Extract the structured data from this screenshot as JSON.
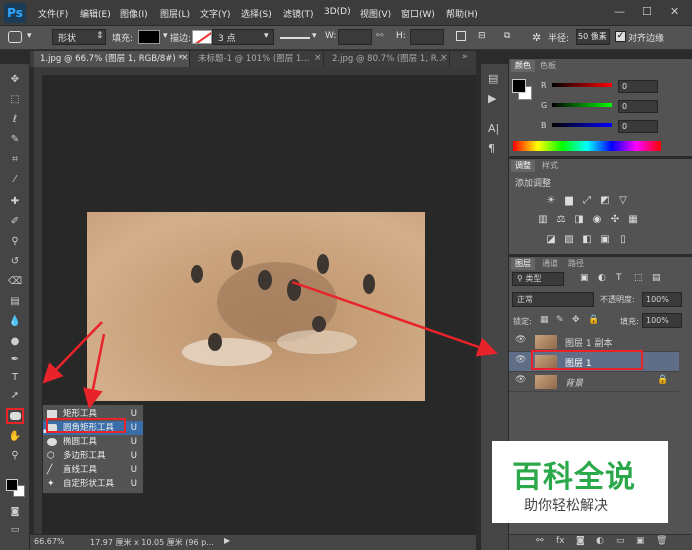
{
  "app": {
    "logo": "Ps"
  },
  "menu": [
    "文件(F)",
    "编辑(E)",
    "图像(I)",
    "图层(L)",
    "文字(Y)",
    "选择(S)",
    "滤镜(T)",
    "3D(D)",
    "视图(V)",
    "窗口(W)",
    "帮助(H)"
  ],
  "window_controls": {
    "min": "—",
    "max": "☐",
    "close": "✕"
  },
  "options": {
    "mode": "形状",
    "fill_label": "填充:",
    "stroke_label": "描边:",
    "stroke_size": "3 点",
    "w_label": "W:",
    "h_label": "H:",
    "radius_label": "半径:",
    "radius_value": "50 像素",
    "align_edges": "对齐边缘"
  },
  "tabs": [
    {
      "label": "1.jpg @ 66.7% (图层 1, RGB/8#) *",
      "close": "×"
    },
    {
      "label": "未标题-1 @ 101% (图层 1...",
      "close": "×"
    },
    {
      "label": "2.jpg @ 80.7% (图层 1, R...",
      "close": "×"
    }
  ],
  "status": {
    "zoom": "66.67%",
    "info": "17.97 厘米 x 10.05 厘米 (96 p..."
  },
  "flyout": [
    {
      "label": "矩形工具",
      "key": "U"
    },
    {
      "label": "圆角矩形工具",
      "key": "U"
    },
    {
      "label": "椭圆工具",
      "key": "U"
    },
    {
      "label": "多边形工具",
      "key": "U"
    },
    {
      "label": "直线工具",
      "key": "U"
    },
    {
      "label": "自定形状工具",
      "key": "U"
    }
  ],
  "color_panel": {
    "tabs": [
      "颜色",
      "色板"
    ],
    "channels": [
      {
        "label": "R",
        "value": "0",
        "color": "#ff3b3b"
      },
      {
        "label": "G",
        "value": "0",
        "color": "#3bd23b"
      },
      {
        "label": "B",
        "value": "0",
        "color": "#3b5bff"
      }
    ]
  },
  "adjust_panel": {
    "tabs": [
      "调整",
      "样式"
    ],
    "title": "添加调整"
  },
  "layers_panel": {
    "tabs": [
      "图层",
      "通道",
      "路径"
    ],
    "kind": "类型",
    "blend": "正常",
    "opacity_label": "不透明度:",
    "opacity": "100%",
    "lock_label": "锁定:",
    "fill_label": "填充:",
    "fill": "100%",
    "layers": [
      {
        "name": "图层 1 副本"
      },
      {
        "name": "图层 1"
      },
      {
        "name": "背景"
      }
    ]
  },
  "watermark": {
    "title": "百科全说",
    "subtitle": "助你轻松解决"
  },
  "colors": {
    "accent_red": "#e8232a",
    "ps_blue": "#31a8ff",
    "watermark_green": "#2aa84a"
  }
}
